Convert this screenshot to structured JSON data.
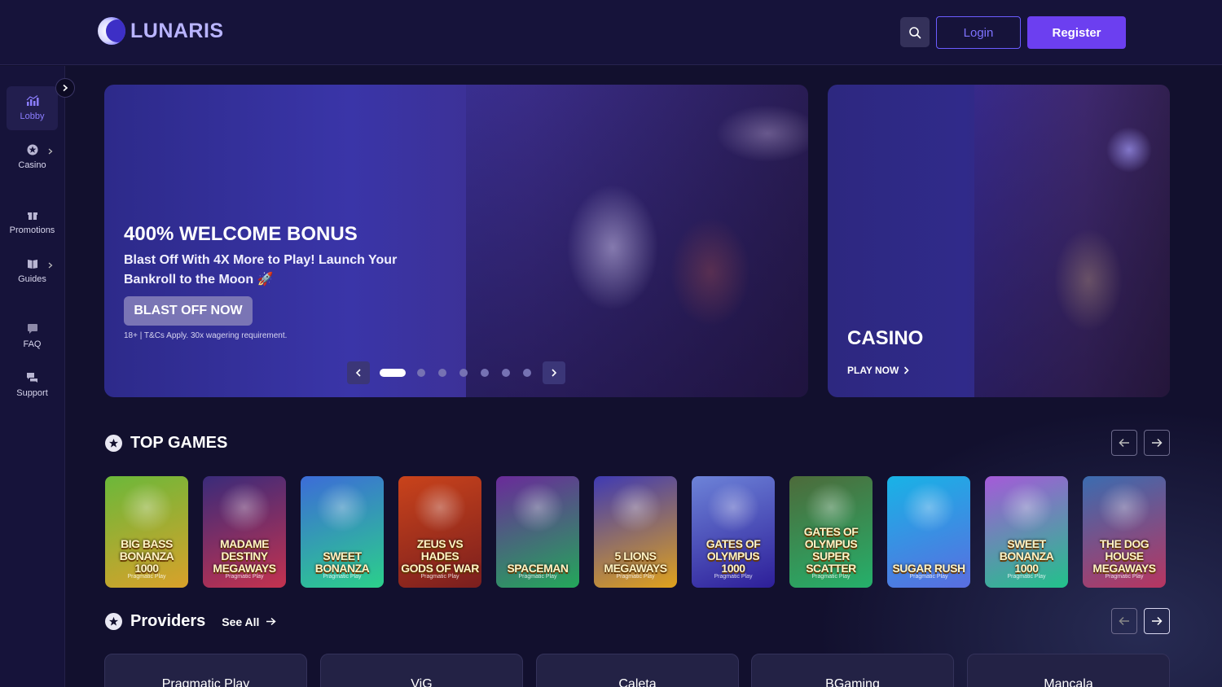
{
  "header": {
    "logo_text": "LUNARIS",
    "login_label": "Login",
    "register_label": "Register"
  },
  "sidebar": {
    "items": [
      {
        "label": "Lobby",
        "icon": "chart-icon",
        "active": true
      },
      {
        "label": "Casino",
        "icon": "casino-chip-icon",
        "has_submenu": true
      },
      {
        "label": "Promotions",
        "icon": "gift-icon"
      },
      {
        "label": "Guides",
        "icon": "book-icon",
        "has_submenu": true
      },
      {
        "label": "FAQ",
        "icon": "chat-question-icon"
      },
      {
        "label": "Support",
        "icon": "support-chat-icon"
      }
    ]
  },
  "hero": {
    "title": "400% WELCOME BONUS",
    "subtitle": "Blast Off With 4X More to Play! Launch Your Bankroll to the Moon 🚀",
    "cta_label": "BLAST OFF NOW",
    "terms": "18+ | T&Cs Apply. 30x wagering requirement.",
    "slide_count": 8,
    "active_slide": 1
  },
  "casino_card": {
    "title": "CASINO",
    "cta_label": "PLAY NOW"
  },
  "top_games": {
    "title": "TOP GAMES",
    "games": [
      {
        "title": "BIG BASS\nBONANZA\n1000",
        "provider": "Pragmatic Play",
        "colors": [
          "#6bb83a",
          "#d9a12a"
        ]
      },
      {
        "title": "MADAME\nDESTINY\nMEGAWAYS",
        "provider": "Pragmatic Play",
        "colors": [
          "#3a2b7a",
          "#c4324f"
        ]
      },
      {
        "title": "SWEET\nBONANZA",
        "provider": "Pragmatic Play",
        "colors": [
          "#3c6cd8",
          "#2bd08a"
        ]
      },
      {
        "title": "ZEUS VS HADES\nGODS OF WAR",
        "provider": "Pragmatic Play",
        "colors": [
          "#c9431b",
          "#7a1e1e"
        ]
      },
      {
        "title": "SPACEMAN",
        "provider": "Pragmatic Play",
        "colors": [
          "#6a2a9a",
          "#23a85a"
        ]
      },
      {
        "title": "5 LIONS\nMEGAWAYS",
        "provider": "Pragmatic Play",
        "colors": [
          "#3f3ab3",
          "#e0a21c"
        ]
      },
      {
        "title": "GATES OF\nOLYMPUS\n1000",
        "provider": "Pragmatic Play",
        "colors": [
          "#6d83d8",
          "#2d1e99"
        ]
      },
      {
        "title": "GATES OF\nOLYMPUS\nSUPER SCATTER",
        "provider": "Pragmatic Play",
        "colors": [
          "#4d6a3a",
          "#25b06b"
        ]
      },
      {
        "title": "SUGAR RUSH",
        "provider": "Pragmatic Play",
        "colors": [
          "#18b3e6",
          "#5a6de0"
        ]
      },
      {
        "title": "SWEET\nBONANZA\n1000",
        "provider": "Pragmatic Play",
        "colors": [
          "#a55ad9",
          "#21c28a"
        ]
      },
      {
        "title": "THE DOG HOUSE\nMEGAWAYS",
        "provider": "Pragmatic Play",
        "colors": [
          "#3b6cb0",
          "#b83560"
        ]
      }
    ]
  },
  "providers": {
    "title": "Providers",
    "see_all_label": "See All",
    "items": [
      "Pragmatic Play",
      "ViG",
      "Caleta",
      "BGaming",
      "Mancala"
    ]
  },
  "colors": {
    "background": "#12102e",
    "accent": "#6c3ff0",
    "header_bg": "#16133a"
  }
}
